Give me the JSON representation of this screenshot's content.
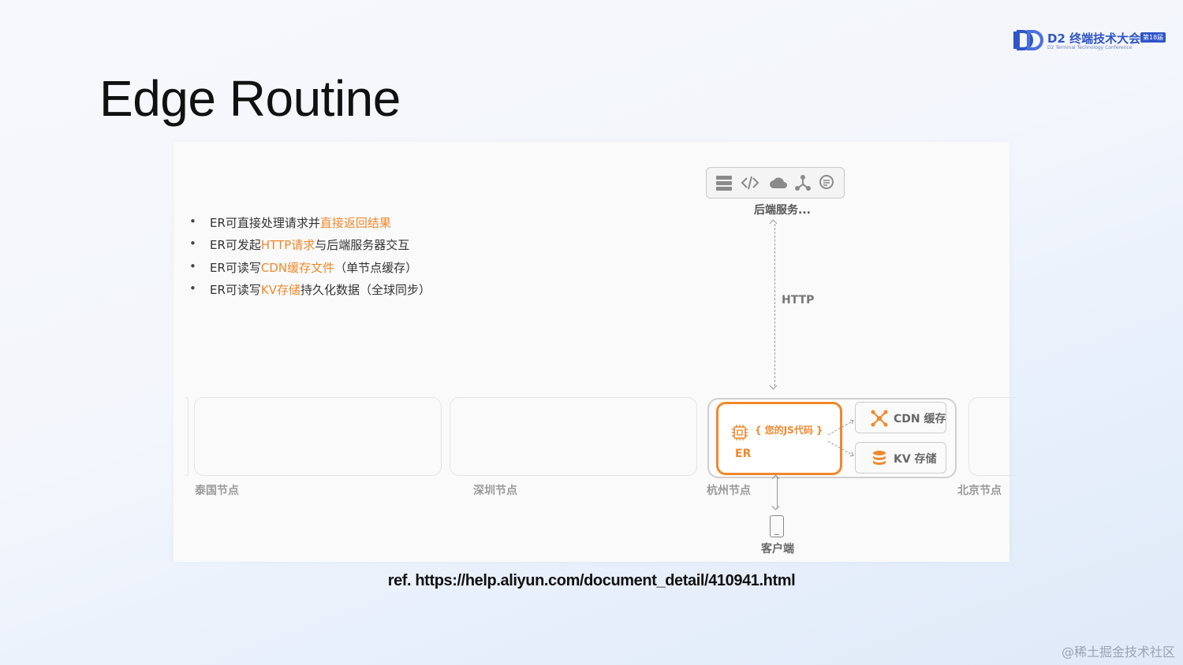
{
  "brand": {
    "title": "D2 终端技术大会",
    "badge": "第18届",
    "subtitle": "D2 Terminal Technology Conference",
    "color": "#2f55c8"
  },
  "slide": {
    "title": "Edge Routine"
  },
  "bullets": [
    {
      "prefix": "ER可直接处理请求并",
      "highlight": "直接返回结果",
      "suffix": ""
    },
    {
      "prefix": "ER可发起",
      "highlight": "HTTP请求",
      "suffix": "与后端服务器交互"
    },
    {
      "prefix": "ER可读写",
      "highlight": "CDN缓存文件",
      "suffix": "（单节点缓存）"
    },
    {
      "prefix": "ER可读写",
      "highlight": "KV存储",
      "suffix": "持久化数据（全球同步）"
    }
  ],
  "diagram": {
    "backend_label": "后端服务...",
    "backend_icons": [
      "server-icon",
      "code-icon",
      "cloud-icon",
      "network-icon",
      "search-icon"
    ],
    "http_label": "HTTP",
    "nodes": [
      "泰国节点",
      "深圳节点",
      "杭州节点",
      "北京节点"
    ],
    "js_code_label": "{ 您的JS代码 }",
    "er_label": "ER",
    "cdn_label": "CDN 缓存",
    "kv_label": "KV 存储",
    "client_label": "客户端",
    "accent_color": "#f0882c"
  },
  "footer": {
    "ref": "ref. https://help.aliyun.com/document_detail/410941.html",
    "watermark": "@稀土掘金技术社区"
  }
}
